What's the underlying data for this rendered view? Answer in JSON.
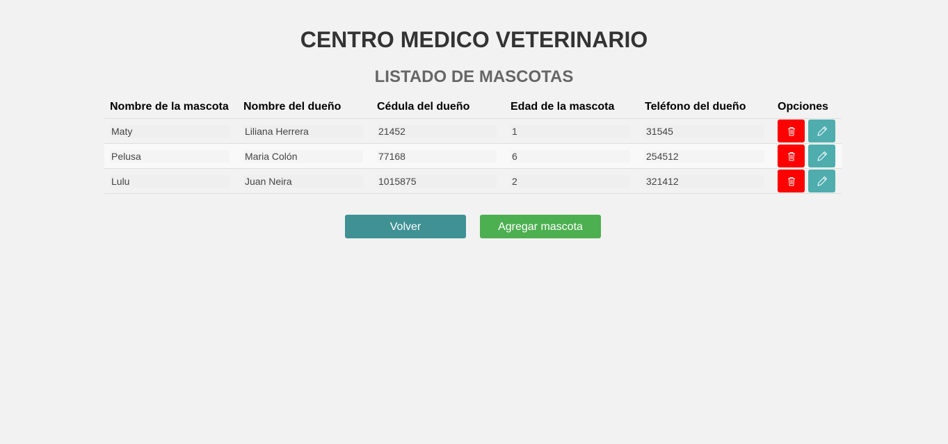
{
  "header": {
    "title": "CENTRO MEDICO VETERINARIO",
    "subtitle": "LISTADO DE MASCOTAS"
  },
  "table": {
    "columns": [
      "Nombre de la mascota",
      "Nombre del dueño",
      "Cédula del dueño",
      "Edad de la mascota",
      "Teléfono del dueño",
      "Opciones"
    ],
    "rows": [
      [
        "Maty",
        "Liliana Herrera",
        "21452",
        "1",
        "31545"
      ],
      [
        "Pelusa",
        "Maria Colón",
        "77168",
        "6",
        "254512"
      ],
      [
        "Lulu",
        "Juan Neira",
        "1015875",
        "2",
        "321412"
      ]
    ],
    "row_actions": {
      "delete_icon": "trash-icon",
      "edit_icon": "pencil-icon"
    }
  },
  "actions": {
    "back_label": "Volver",
    "add_label": "Agregar mascota"
  },
  "colors": {
    "background": "#f2f2f2",
    "delete": "#ff0000",
    "edit": "#4fadae",
    "back": "#3f9194",
    "add": "#4caf50"
  }
}
